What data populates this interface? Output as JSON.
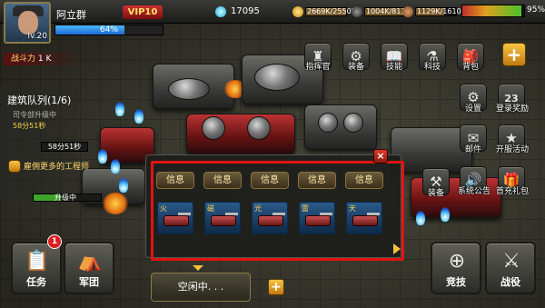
{
  "player": {
    "name": "阿立群",
    "level": "lv.20",
    "vip": "VIP10",
    "exp_percent_text": "64%",
    "exp_fraction": 0.64,
    "power_label": "战斗力",
    "power_value": "1 K"
  },
  "resources": {
    "diamonds": "17095",
    "gold": "2669K/2550K",
    "oil": "1004K/813K",
    "steel": "1129K/1610K",
    "energy_percent_text": "95%",
    "energy_fraction": 0.95
  },
  "menu": {
    "commander": "指挥官",
    "equipment": "装备",
    "skills": "技能",
    "tech": "科技",
    "backpack": "背包",
    "settings": "设置",
    "login_reward": "登录奖励",
    "mail": "邮件",
    "server_event": "开服活动",
    "notice": "系统公告",
    "first_charge": "首充礼包",
    "equip2": "装备",
    "calendar_day": "23"
  },
  "build_queue": {
    "title": "建筑队列(1/6)",
    "status": "司令部升级中",
    "time_left": "58分51秒",
    "timer": "58分51秒",
    "more_builders": "雇佣更多的工程师",
    "upgrading": "升级中"
  },
  "popup": {
    "info_labels": [
      "信息",
      "信息",
      "信息",
      "信息",
      "信息"
    ],
    "unit_tags": [
      "火",
      "磁",
      "光",
      "雷",
      "天"
    ],
    "close": "×"
  },
  "bottom": {
    "task": "任务",
    "task_badge": "1",
    "legion": "军团",
    "idle": "空闲中. . .",
    "arena": "竞技",
    "battle": "战役"
  },
  "colors": {
    "highlight": "#e21313",
    "vip_bg": "#d03030",
    "gold_accent": "#f7c442"
  }
}
